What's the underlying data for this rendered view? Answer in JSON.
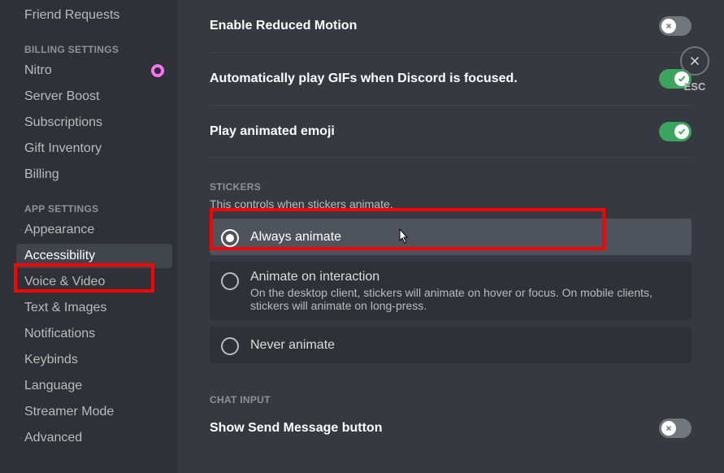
{
  "sidebar": {
    "items_top": [
      {
        "label": "Friend Requests",
        "name": "sidebar-item-friend-requests"
      }
    ],
    "billing_header": "BILLING SETTINGS",
    "billing_items": [
      {
        "label": "Nitro",
        "name": "sidebar-item-nitro",
        "badge": true
      },
      {
        "label": "Server Boost",
        "name": "sidebar-item-server-boost"
      },
      {
        "label": "Subscriptions",
        "name": "sidebar-item-subscriptions"
      },
      {
        "label": "Gift Inventory",
        "name": "sidebar-item-gift-inventory"
      },
      {
        "label": "Billing",
        "name": "sidebar-item-billing"
      }
    ],
    "app_header": "APP SETTINGS",
    "app_items": [
      {
        "label": "Appearance",
        "name": "sidebar-item-appearance"
      },
      {
        "label": "Accessibility",
        "name": "sidebar-item-accessibility",
        "selected": true
      },
      {
        "label": "Voice & Video",
        "name": "sidebar-item-voice-video"
      },
      {
        "label": "Text & Images",
        "name": "sidebar-item-text-images"
      },
      {
        "label": "Notifications",
        "name": "sidebar-item-notifications"
      },
      {
        "label": "Keybinds",
        "name": "sidebar-item-keybinds"
      },
      {
        "label": "Language",
        "name": "sidebar-item-language"
      },
      {
        "label": "Streamer Mode",
        "name": "sidebar-item-streamer-mode"
      },
      {
        "label": "Advanced",
        "name": "sidebar-item-advanced"
      }
    ]
  },
  "settings": {
    "reduced_motion": {
      "title": "Enable Reduced Motion",
      "on": false
    },
    "autoplay_gifs": {
      "title": "Automatically play GIFs when Discord is focused.",
      "on": true
    },
    "animated_emoji": {
      "title": "Play animated emoji",
      "on": true
    },
    "stickers": {
      "header": "STICKERS",
      "desc": "This controls when stickers animate.",
      "options": [
        {
          "title": "Always animate",
          "desc": "",
          "selected": true
        },
        {
          "title": "Animate on interaction",
          "desc": "On the desktop client, stickers will animate on hover or focus. On mobile clients, stickers will animate on long-press.",
          "selected": false
        },
        {
          "title": "Never animate",
          "desc": "",
          "selected": false
        }
      ]
    },
    "chat_input": {
      "header": "CHAT INPUT",
      "show_send": {
        "title": "Show Send Message button",
        "on": false
      }
    }
  },
  "esc_label": "ESC"
}
